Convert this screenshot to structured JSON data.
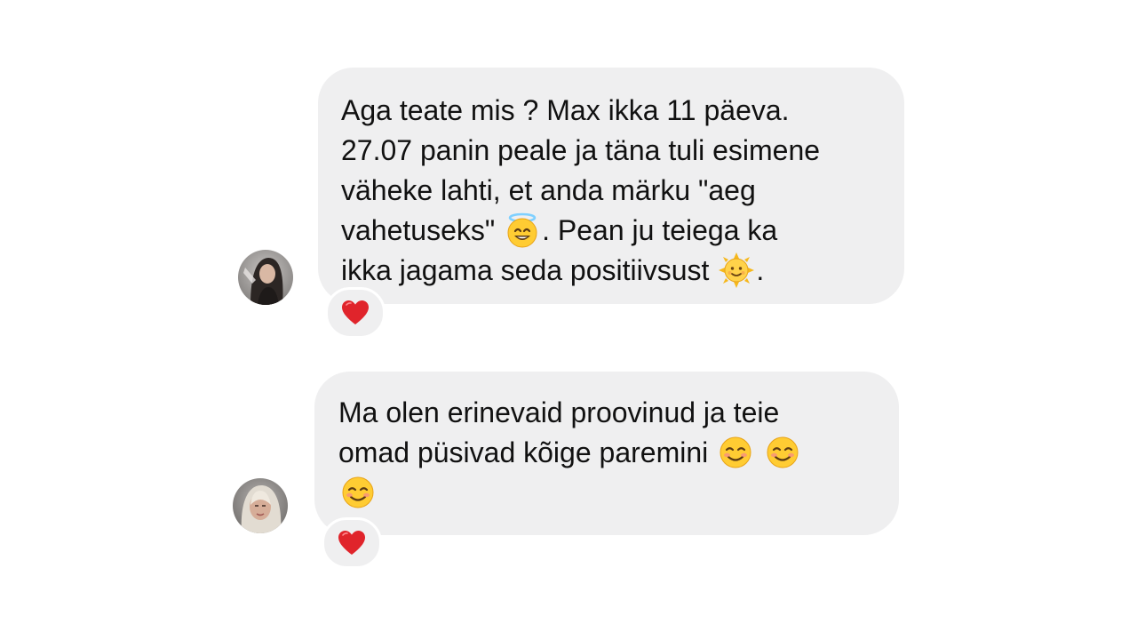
{
  "messages": [
    {
      "avatar": "avatar-dark-hair",
      "lines": [
        "Aga teate mis ? Max ikka 11 päeva.",
        "27.07 panin peale ja täna tuli esimene",
        "väheke lahti, et anda märku \"aeg",
        "vahetuseks\"",
        ". Pean ju teiega ka",
        "ikka jagama seda positiivsust",
        "."
      ],
      "emojis": [
        "smiling-face-with-halo-icon",
        "sun-with-face-icon"
      ],
      "reaction": "red-heart-icon"
    },
    {
      "avatar": "avatar-blonde-hair",
      "lines": [
        "Ma olen erinevaid proovinud ja teie",
        "omad püsivad kõige paremini"
      ],
      "emojis": [
        "smiling-face-icon",
        "smiling-face-icon",
        "smiling-face-icon"
      ],
      "reaction": "red-heart-icon"
    }
  ],
  "colors": {
    "bubble": "#efeff0",
    "text": "#111111",
    "heart": "#e0242b",
    "background": "#ffffff"
  }
}
